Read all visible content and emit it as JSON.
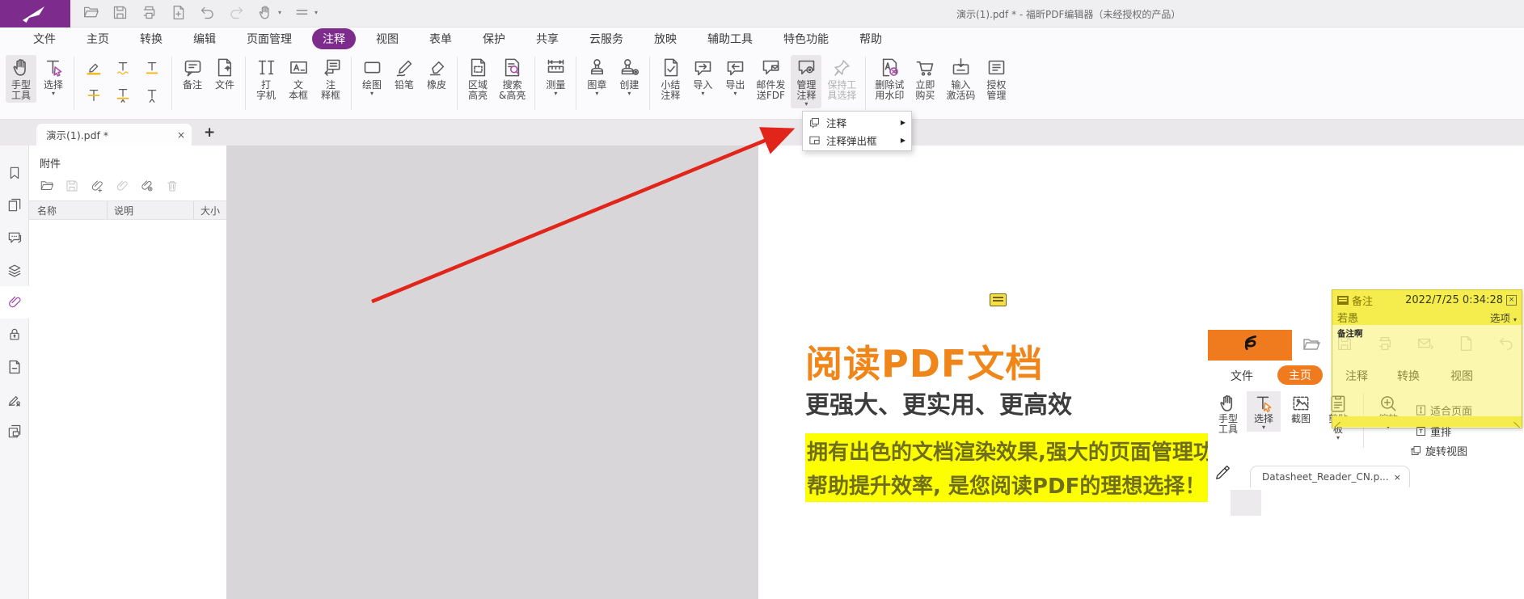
{
  "titlebar": {
    "title": "演示(1).pdf * - 福昕PDF编辑器（未经授权的产品）",
    "quick_access": [
      {
        "name": "open-file-icon",
        "icon": "qFolder"
      },
      {
        "name": "save-icon",
        "icon": "qSave"
      },
      {
        "name": "print-icon",
        "icon": "qPrint"
      },
      {
        "name": "new-document-icon",
        "icon": "qPage"
      },
      {
        "name": "undo-icon",
        "icon": "qUndo"
      },
      {
        "name": "redo-icon",
        "icon": "qRedo",
        "lite": true
      },
      {
        "name": "hand-quick-icon",
        "icon": "hand",
        "caret": true
      },
      {
        "name": "customize-toolbar-icon",
        "icon": "qMenu",
        "caret": true
      }
    ]
  },
  "menubar": {
    "items": [
      "文件",
      "主页",
      "转换",
      "编辑",
      "页面管理",
      "注释",
      "视图",
      "表单",
      "保护",
      "共享",
      "云服务",
      "放映",
      "辅助工具",
      "特色功能",
      "帮助"
    ],
    "active": "注释"
  },
  "ribbon": {
    "groups": [
      {
        "buttons": [
          {
            "name": "hand-tool-button",
            "icon": "hand",
            "lines": [
              "手型",
              "工具"
            ],
            "selected": true
          },
          {
            "name": "select-tool-button",
            "icon": "select",
            "lines": [
              "选择"
            ],
            "dropdown": true
          }
        ]
      },
      {
        "markup_grid": [
          {
            "name": "highlight-text-button",
            "icon": "mkHighlight"
          },
          {
            "name": "squiggly-underline-button",
            "icon": "mkSquiggly"
          },
          {
            "name": "underline-text-button",
            "icon": "mkUnderline"
          },
          {
            "name": "strikeout-text-button",
            "icon": "mkStrike"
          },
          {
            "name": "replace-text-button",
            "icon": "mkReplace"
          },
          {
            "name": "insert-text-button",
            "icon": "mkCaret"
          }
        ]
      },
      {
        "buttons": [
          {
            "name": "note-comment-button",
            "icon": "note",
            "lines": [
              "备注"
            ]
          },
          {
            "name": "file-attachment-comment-button",
            "icon": "filePin",
            "lines": [
              "文件"
            ]
          }
        ]
      },
      {
        "buttons": [
          {
            "name": "typewriter-button",
            "icon": "typewriter",
            "lines": [
              "打",
              "字机"
            ]
          },
          {
            "name": "textbox-button",
            "icon": "textbox",
            "lines": [
              "文",
              "本框"
            ]
          },
          {
            "name": "callout-button",
            "icon": "callout",
            "lines": [
              "注",
              "释框"
            ]
          }
        ]
      },
      {
        "buttons": [
          {
            "name": "drawing-button",
            "icon": "drawing",
            "lines": [
              "绘图"
            ],
            "dropdown": true
          },
          {
            "name": "pencil-button",
            "icon": "pencil",
            "lines": [
              "铅笔"
            ]
          },
          {
            "name": "eraser-button",
            "icon": "eraser",
            "lines": [
              "橡皮"
            ]
          }
        ]
      },
      {
        "buttons": [
          {
            "name": "area-highlight-button",
            "icon": "areaHl",
            "lines": [
              "区域",
              "高亮"
            ]
          },
          {
            "name": "search-highlight-button",
            "icon": "searchHl",
            "lines": [
              "搜索",
              "&高亮"
            ]
          }
        ]
      },
      {
        "buttons": [
          {
            "name": "measure-button",
            "icon": "measure",
            "lines": [
              "测量"
            ],
            "dropdown": true
          }
        ]
      },
      {
        "buttons": [
          {
            "name": "stamp-button",
            "icon": "stamp",
            "lines": [
              "图章"
            ],
            "dropdown": true
          },
          {
            "name": "create-stamp-button",
            "icon": "createStamp",
            "lines": [
              "创建"
            ],
            "dropdown": true
          }
        ]
      },
      {
        "buttons": [
          {
            "name": "summarize-comments-button",
            "icon": "summary",
            "lines": [
              "小结",
              "注释"
            ]
          },
          {
            "name": "import-comments-button",
            "icon": "importC",
            "lines": [
              "导入"
            ],
            "dropdown": true
          },
          {
            "name": "export-comments-button",
            "icon": "exportC",
            "lines": [
              "导出"
            ],
            "dropdown": true
          },
          {
            "name": "email-fdf-button",
            "icon": "emailFdf",
            "lines": [
              "邮件发",
              "送FDF"
            ]
          },
          {
            "name": "manage-comments-button",
            "icon": "manage",
            "lines": [
              "管理",
              "注释"
            ],
            "dropdown": true,
            "selected": true
          },
          {
            "name": "keep-tool-selected-button",
            "icon": "pin",
            "lines": [
              "保持工",
              "具选择"
            ],
            "disabled": true
          }
        ]
      },
      {
        "buttons": [
          {
            "name": "remove-trial-watermark-button",
            "icon": "delWm",
            "lines": [
              "删除试",
              "用水印"
            ]
          },
          {
            "name": "buy-now-button",
            "icon": "cart",
            "lines": [
              "立即",
              "购买"
            ]
          },
          {
            "name": "enter-activation-code-button",
            "icon": "activate",
            "lines": [
              "输入",
              "激活码"
            ]
          },
          {
            "name": "license-manage-button",
            "icon": "license",
            "lines": [
              "授权",
              "管理"
            ]
          }
        ]
      }
    ]
  },
  "dropdown": {
    "items": [
      {
        "label": "注释",
        "icon": "ddComment"
      },
      {
        "label": "注释弹出框",
        "icon": "ddPopup"
      }
    ]
  },
  "tabbar": {
    "tab_label": "演示(1).pdf *",
    "close": "×",
    "new_tab": "+"
  },
  "left_rail": {
    "items": [
      {
        "name": "bookmarks-panel-icon",
        "icon": "bookmark"
      },
      {
        "name": "pages-panel-icon",
        "icon": "pages"
      },
      {
        "name": "comments-panel-icon",
        "icon": "comments"
      },
      {
        "name": "layers-panel-icon",
        "icon": "layers"
      },
      {
        "name": "attachments-panel-icon",
        "icon": "clip",
        "active": true
      },
      {
        "name": "security-panel-icon",
        "icon": "lock"
      },
      {
        "name": "destinations-panel-icon",
        "icon": "docMinus"
      },
      {
        "name": "signature-panel-icon",
        "icon": "sign"
      },
      {
        "name": "fields-panel-icon",
        "icon": "copyNote"
      }
    ]
  },
  "attachments_panel": {
    "title": "附件",
    "toolbar": [
      {
        "name": "open-attachment-icon",
        "icon": "aFolder"
      },
      {
        "name": "save-attachment-icon",
        "icon": "qSave",
        "dim": true
      },
      {
        "name": "add-attachment-icon",
        "icon": "aClipAdd"
      },
      {
        "name": "attachment-icon",
        "icon": "aClip",
        "dim": true
      },
      {
        "name": "attachment-settings-icon",
        "icon": "aClipGear"
      },
      {
        "name": "delete-attachment-icon",
        "icon": "aTrash",
        "dim": true
      }
    ],
    "columns": [
      "名称",
      "说明",
      "大小"
    ]
  },
  "document": {
    "heading": "阅读PDF文档",
    "subheading": "更强大、更实用、更高效",
    "highlight_line1": "拥有出色的文档渲染效果,强大的页面管理功能,",
    "highlight_line2": "帮助提升效率, 是您阅读PDF的理想选择！",
    "bars_row1": [
      "#3e4e78",
      "#f4a9a0",
      "#62cfa8",
      "#ec8b33"
    ],
    "bars_row2": [
      "#ec8b33",
      "#62cfa8",
      "#f4a9a0",
      "#3e4e78"
    ]
  },
  "sticky_note": {
    "title": "备注",
    "timestamp": "2022/7/25 0:34:28",
    "author": "若愚",
    "options_label": "选项",
    "body": "备注啊",
    "close": "×"
  },
  "embedded": {
    "tabs": [
      "文件",
      "主页",
      "注释",
      "转换",
      "视图"
    ],
    "active_tab": "主页",
    "tools": {
      "hand": "手型工具",
      "select": "选择",
      "snapshot": "截图",
      "clipboard": "剪贴板",
      "zoom": "缩放",
      "fit_page": "适合页面",
      "reflow": "重排",
      "rotate": "旋转视图"
    },
    "doc_tab": "Datasheet_Reader_CN.p...",
    "close": "×"
  },
  "colors": {
    "brand_purple": "#7d2b8d",
    "heading_orange": "#f08519",
    "reader_orange": "#f07b1f",
    "note_yellow": "#f5ed4d",
    "text_highlight": "#fdff00",
    "arrow_red": "#e1251b"
  }
}
